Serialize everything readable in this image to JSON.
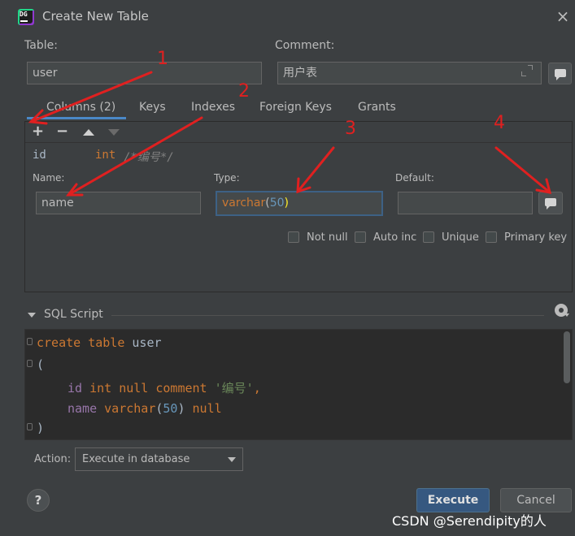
{
  "window": {
    "title": "Create New Table",
    "app_icon_text": "DG"
  },
  "table": {
    "label": "Table:",
    "value": "user"
  },
  "comment": {
    "label": "Comment:",
    "value": "用户表"
  },
  "tabs": [
    {
      "label": "Columns (2)"
    },
    {
      "label": "Keys"
    },
    {
      "label": "Indexes"
    },
    {
      "label": "Foreign Keys"
    },
    {
      "label": "Grants"
    }
  ],
  "toolbar": {
    "add": "+",
    "remove": "−"
  },
  "column_list": [
    {
      "name": "id",
      "type": "int",
      "comment": "/*编号*/"
    }
  ],
  "column_editor": {
    "name_label": "Name:",
    "name_value": "name",
    "type_label": "Type:",
    "type_value_base": "varchar",
    "type_value_paren_open": "(",
    "type_value_num": "50",
    "type_value_paren_close": ")",
    "default_label": "Default:",
    "default_value": ""
  },
  "options": [
    {
      "label": "Not null",
      "checked": false
    },
    {
      "label": "Auto inc",
      "checked": false
    },
    {
      "label": "Unique",
      "checked": false
    },
    {
      "label": "Primary key",
      "checked": false
    }
  ],
  "sql_script": {
    "header": "SQL Script",
    "lines": {
      "l1_kw": "create table",
      "l1_id": " user",
      "l2": "(",
      "l3_field": "id",
      "l3_kw": " int null comment",
      "l3_str": " '编号'",
      "l3_end": ",",
      "l4_field": "name",
      "l4_kw1": " varchar",
      "l4_p1": "(",
      "l4_num": "50",
      "l4_p2": ")",
      "l4_kw2": " null",
      "l5": ")"
    }
  },
  "action": {
    "label": "Action:",
    "selected": "Execute in database"
  },
  "buttons": {
    "help": "?",
    "execute": "Execute",
    "cancel": "Cancel"
  },
  "annotations": {
    "n1": "1",
    "n2": "2",
    "n3": "3",
    "n4": "4"
  },
  "watermark": "CSDN @Serendipity的人",
  "colors": {
    "accent": "#4a88c7",
    "primary_button": "#365880",
    "annotation_red": "#e02020"
  }
}
